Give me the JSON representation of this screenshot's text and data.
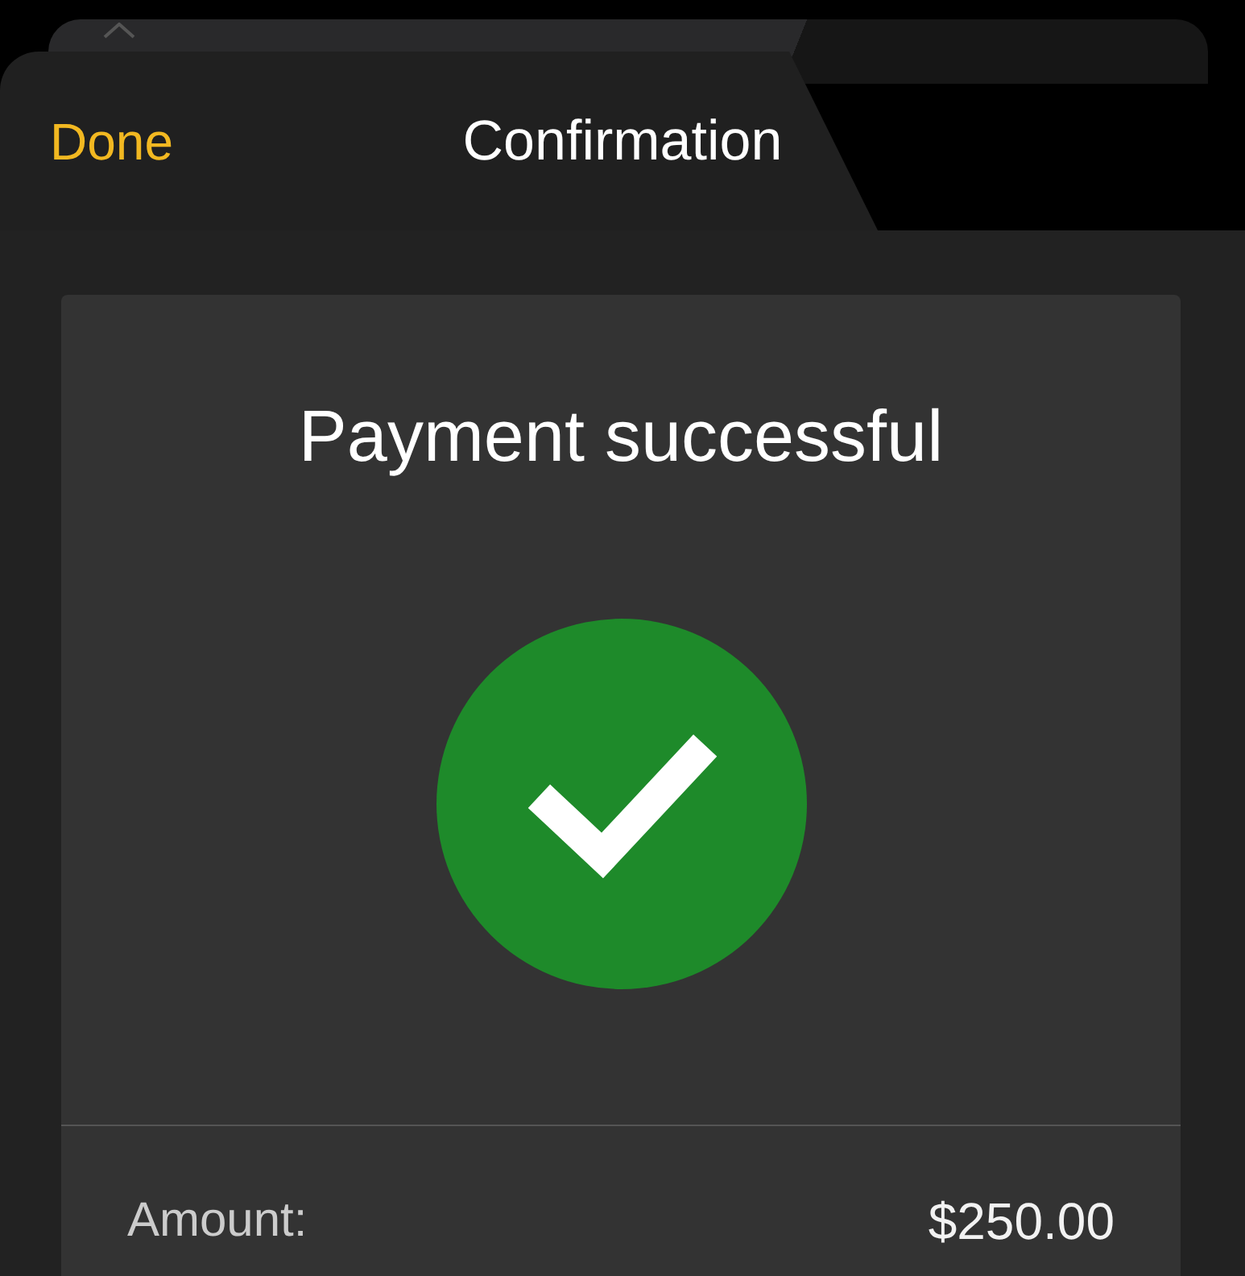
{
  "header": {
    "done_label": "Done",
    "title": "Confirmation"
  },
  "card": {
    "heading": "Payment successful",
    "success": true,
    "details": [
      {
        "label": "Amount:",
        "value": "$250.00"
      }
    ]
  }
}
